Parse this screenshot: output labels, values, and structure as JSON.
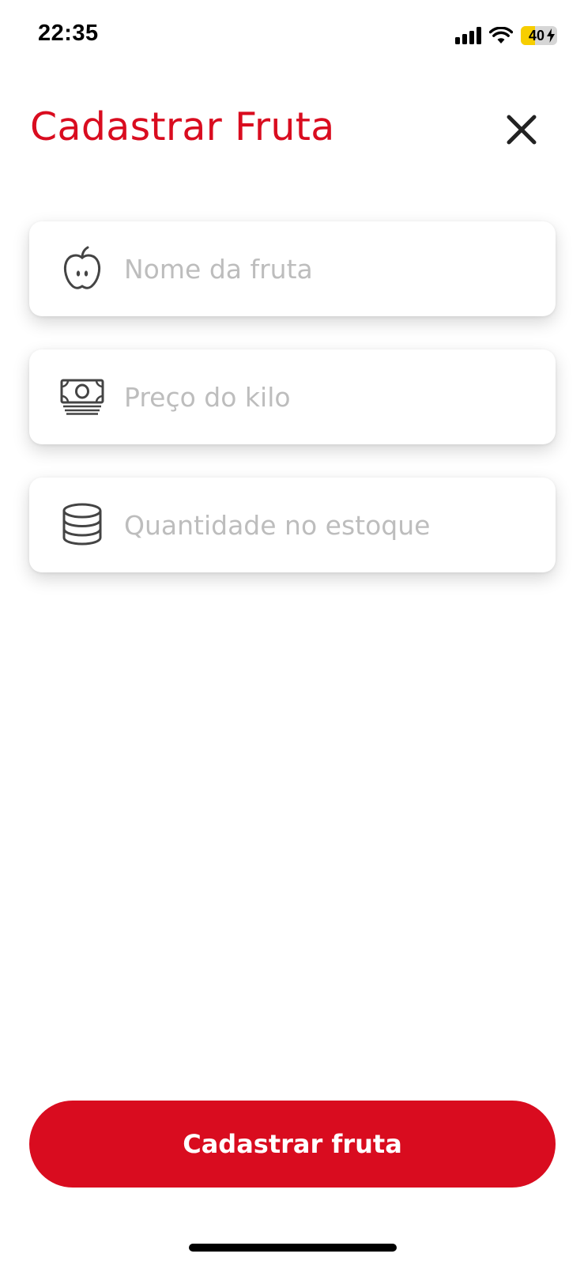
{
  "status_bar": {
    "time": "22:35",
    "battery_level": "40",
    "battery_fraction": 0.4,
    "signal_bars": 4
  },
  "header": {
    "title": "Cadastrar Fruta",
    "close_icon": "close-icon"
  },
  "form": {
    "fields": [
      {
        "icon": "apple-icon",
        "placeholder": "Nome da fruta",
        "value": ""
      },
      {
        "icon": "money-icon",
        "placeholder": "Preço do kilo",
        "value": ""
      },
      {
        "icon": "stack-icon",
        "placeholder": "Quantidade no estoque",
        "value": ""
      }
    ],
    "submit_label": "Cadastrar fruta"
  },
  "colors": {
    "accent": "#d90c1f",
    "placeholder": "#bdbdbd",
    "battery": "#f7ce00"
  }
}
